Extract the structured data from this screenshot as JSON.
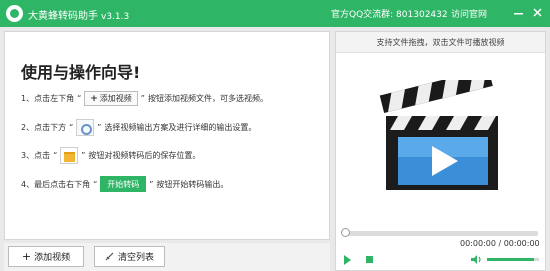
{
  "titlebar": {
    "app_name": "大黄蜂转码助手",
    "version": "v3.1.3",
    "qq_group": "官方QQ交流群: 801302432",
    "visit_site": "访问官网",
    "min_icon": "minimize-icon",
    "close_icon": "close-icon"
  },
  "guide": {
    "title": "使用与操作向导!",
    "quote_open": "“",
    "quote_close": "”",
    "step1": {
      "before": "1、点击左下角",
      "button": "添加视频",
      "after": "按钮添加视频文件，可多选视频。"
    },
    "step2": {
      "before": "2、点击下方",
      "after": "选择视频输出方案及进行详细的输出设置。"
    },
    "step3": {
      "before": "3、点击",
      "after": "按钮对视频转码后的保存位置。"
    },
    "step4": {
      "before": "4、最后点击右下角",
      "button": "开始转码",
      "after": "按钮开始转码输出。"
    }
  },
  "bottom": {
    "add_video": "添加视频",
    "clear_list": "清空列表"
  },
  "player": {
    "hint": "支持文件拖拽，双击文件可播放视频",
    "time": "00:00:00 / 00:00:00",
    "progress": 0,
    "volume": 0.9
  },
  "colors": {
    "accent": "#2fb566",
    "play_blue": "#3a8fd8"
  }
}
